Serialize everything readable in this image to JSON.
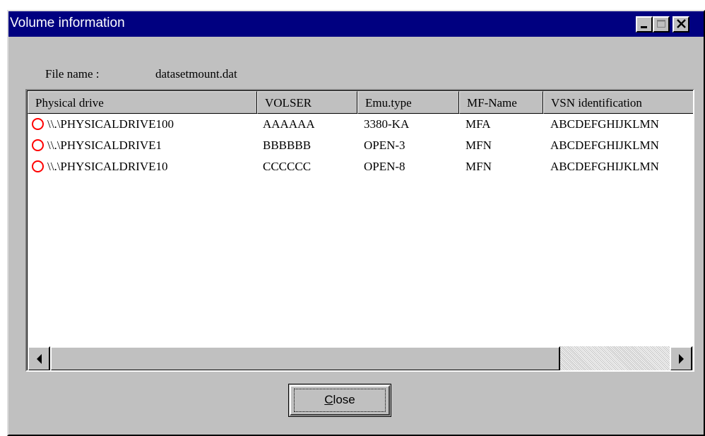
{
  "window": {
    "title": "Volume information"
  },
  "file": {
    "label": "File name :",
    "value": "datasetmount.dat"
  },
  "table": {
    "columns": [
      "Physical drive",
      "VOLSER",
      "Emu.type",
      "MF-Name",
      "VSN  identification"
    ],
    "rows": [
      {
        "icon": "red-circle-icon",
        "drive": "\\\\.\\PHYSICALDRIVE100",
        "volser": "AAAAAA",
        "emu": "3380-KA",
        "mf": "MFA",
        "vsn": "ABCDEFGHIJKLMN"
      },
      {
        "icon": "red-circle-icon",
        "drive": "\\\\.\\PHYSICALDRIVE1",
        "volser": "BBBBBB",
        "emu": "OPEN-3",
        "mf": "MFN",
        "vsn": "ABCDEFGHIJKLMN"
      },
      {
        "icon": "red-circle-icon",
        "drive": "\\\\.\\PHYSICALDRIVE10",
        "volser": "CCCCCC",
        "emu": "OPEN-8",
        "mf": "MFN",
        "vsn": "ABCDEFGHIJKLMN"
      }
    ]
  },
  "buttons": {
    "close_accel": "C",
    "close_rest": "lose"
  },
  "colors": {
    "titlebar": "#000080",
    "face": "#c0c0c0",
    "row_icon": "#ff0000"
  }
}
